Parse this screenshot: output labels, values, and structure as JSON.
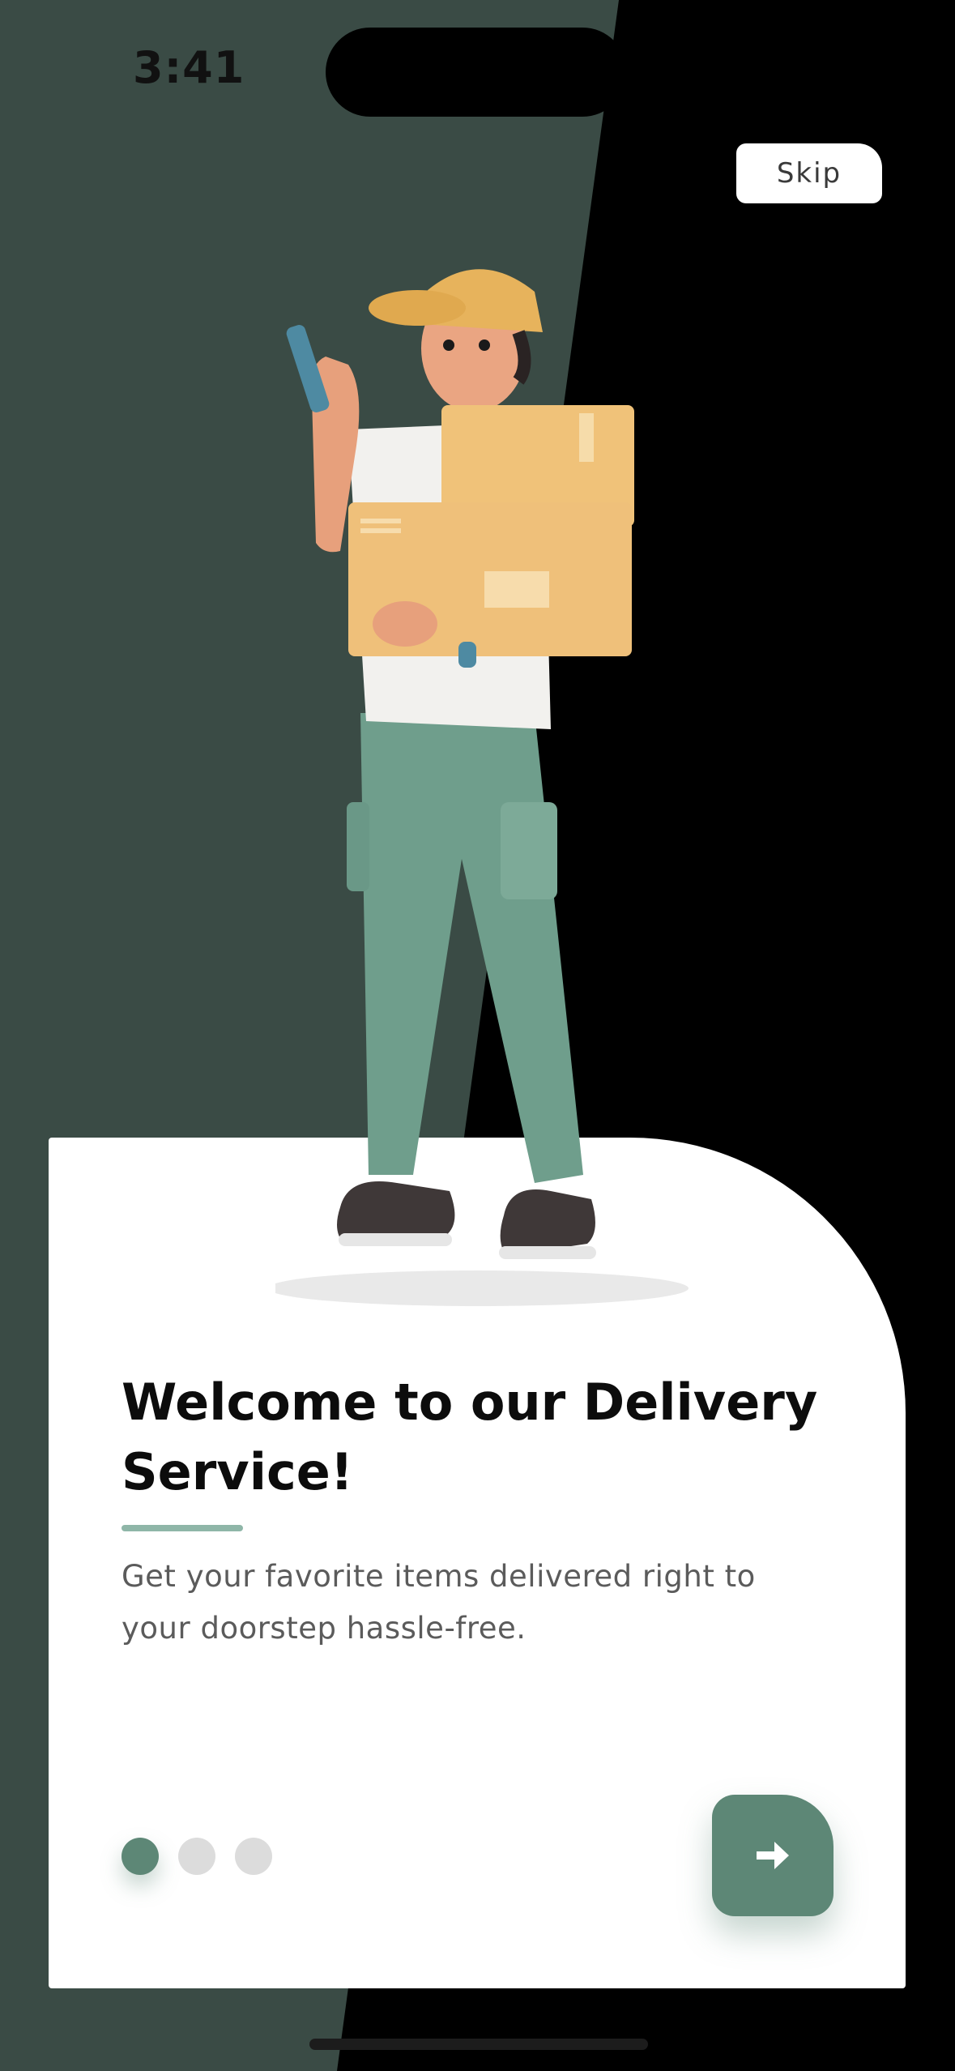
{
  "status_bar": {
    "time": "3:41"
  },
  "header": {
    "skip_label": "Skip"
  },
  "onboarding": {
    "title": "Welcome to our Delivery Service!",
    "description": "Get your favorite items delivered right to your doorstep hassle-free.",
    "page_indicator": {
      "total": 3,
      "active_index": 0
    },
    "next_icon": "arrow-right-icon"
  },
  "illustration": "delivery-person-with-boxes",
  "colors": {
    "left_background": "#3a4b45",
    "right_background": "#000000",
    "accent": "#5d8776",
    "underline": "#8fb6a8",
    "dot_inactive": "#dcdcdc",
    "card": "#ffffff"
  }
}
